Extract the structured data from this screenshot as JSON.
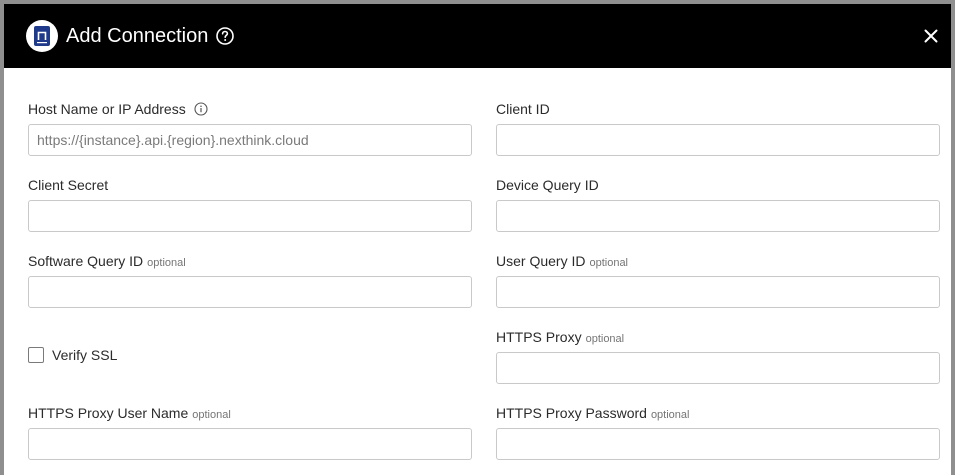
{
  "dialog": {
    "title": "Add Connection",
    "help_icon": "help-circle-icon",
    "close_icon": "close-icon"
  },
  "fields": {
    "host_name": {
      "label": "Host Name or IP Address",
      "value": "",
      "placeholder": "https://{instance}.api.{region}.nexthink.cloud",
      "info_icon": "info-icon"
    },
    "client_id": {
      "label": "Client ID",
      "value": "",
      "placeholder": ""
    },
    "client_secret": {
      "label": "Client Secret",
      "value": "",
      "placeholder": ""
    },
    "device_query_id": {
      "label": "Device Query ID",
      "value": "",
      "placeholder": ""
    },
    "software_query_id": {
      "label": "Software Query ID",
      "optional": "optional",
      "value": "",
      "placeholder": ""
    },
    "user_query_id": {
      "label": "User Query ID",
      "optional": "optional",
      "value": "",
      "placeholder": ""
    },
    "verify_ssl": {
      "label": "Verify SSL",
      "checked": false
    },
    "https_proxy": {
      "label": "HTTPS Proxy",
      "optional": "optional",
      "value": "",
      "placeholder": ""
    },
    "https_proxy_user_name": {
      "label": "HTTPS Proxy User Name",
      "optional": "optional",
      "value": "",
      "placeholder": ""
    },
    "https_proxy_password": {
      "label": "HTTPS Proxy Password",
      "optional": "optional",
      "value": "",
      "placeholder": ""
    }
  },
  "colors": {
    "header_bg": "#000000",
    "header_text": "#ffffff",
    "logo_accent": "#1f3a8a",
    "input_border": "#c9c9c9",
    "optional_text": "#757575"
  }
}
